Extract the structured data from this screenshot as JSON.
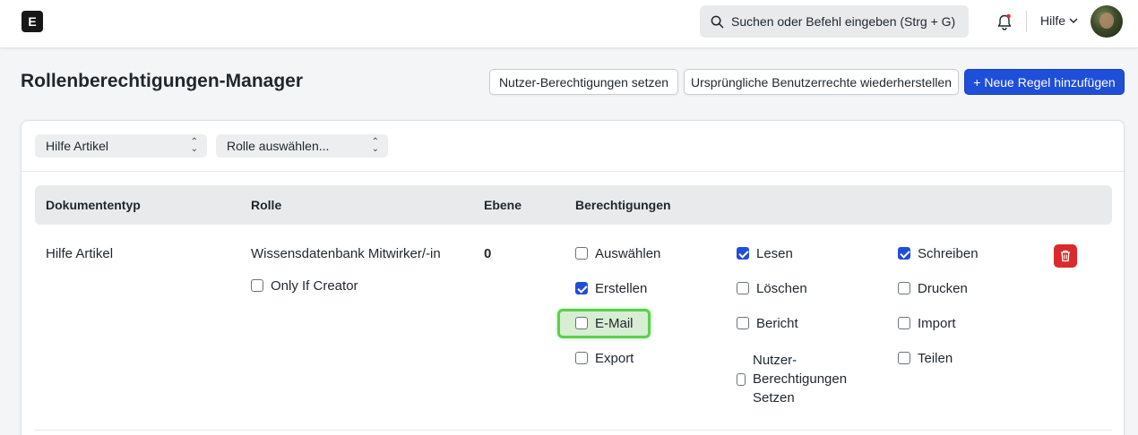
{
  "navbar": {
    "logo": "E",
    "search_placeholder": "Suchen oder Befehl eingeben (Strg + G)",
    "help_label": "Hilfe",
    "icons": [
      "search-icon",
      "bell-icon",
      "chevron-down-icon",
      "avatar"
    ]
  },
  "page": {
    "title": "Rollenberechtigungen-Manager",
    "buttons": {
      "set_user_permissions": "Nutzer-Berechtigungen setzen",
      "restore": "Ursprüngliche Benutzerrechte wiederherstellen",
      "add_rule": "+ Neue Regel hinzufügen"
    }
  },
  "filters": {
    "doctype": "Hilfe Artikel",
    "role": "Rolle auswählen..."
  },
  "table": {
    "headers": [
      "Dokumententyp",
      "Rolle",
      "Ebene",
      "Berechtigungen"
    ],
    "row": {
      "doctype": "Hilfe Artikel",
      "role": "Wissensdatenbank Mitwirker/-in",
      "only_if_creator": {
        "label": "Only If Creator",
        "checked": false
      },
      "level": "0",
      "permissions": [
        {
          "label": "Auswählen",
          "checked": false
        },
        {
          "label": "Lesen",
          "checked": true
        },
        {
          "label": "Schreiben",
          "checked": true
        },
        {
          "label": "Erstellen",
          "checked": true
        },
        {
          "label": "Löschen",
          "checked": false
        },
        {
          "label": "Drucken",
          "checked": false
        },
        {
          "label": "E-Mail",
          "checked": false,
          "highlighted": true
        },
        {
          "label": "Bericht",
          "checked": false
        },
        {
          "label": "Import",
          "checked": false
        },
        {
          "label": "Export",
          "checked": false
        },
        {
          "label": "Nutzer-",
          "checked": false
        },
        {
          "label": "Teilen",
          "checked": false
        }
      ],
      "user_perm_label_lines": [
        "Nutzer-",
        "Berechtigungen",
        "Setzen"
      ]
    }
  },
  "colors": {
    "primary": "#1f4fd8",
    "danger": "#d92b2b",
    "highlight_border": "#5ccf4e"
  }
}
